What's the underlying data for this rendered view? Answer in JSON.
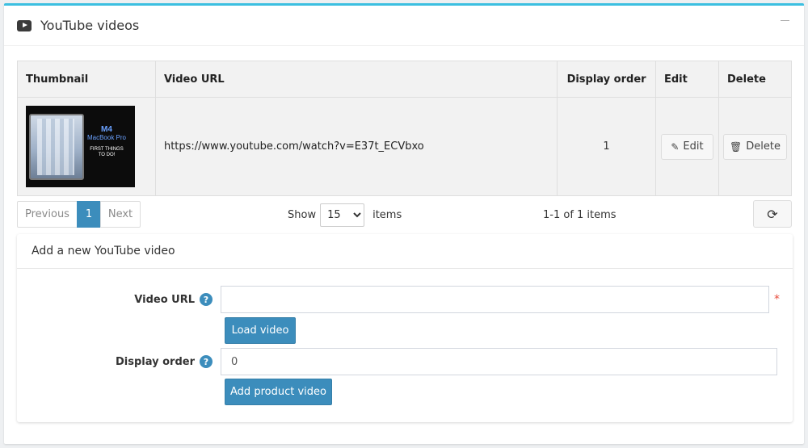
{
  "panel": {
    "title": "YouTube videos",
    "collapse_icon": "minus-icon"
  },
  "table": {
    "headers": {
      "thumbnail": "Thumbnail",
      "video_url": "Video URL",
      "display_order": "Display order",
      "edit": "Edit",
      "delete": "Delete"
    },
    "rows": [
      {
        "thumbnail_text": {
          "line1": "M4",
          "line2": "MacBook Pro",
          "line3": "FIRST THINGS",
          "line4": "TO DO!"
        },
        "video_url": "https://www.youtube.com/watch?v=E37t_ECVbxo",
        "display_order": "1",
        "edit_label": "Edit",
        "delete_label": "Delete"
      }
    ]
  },
  "pager": {
    "previous": "Previous",
    "current_page": "1",
    "next": "Next",
    "show_label": "Show",
    "page_size": "15",
    "items_label": "items",
    "info": "1-1 of 1 items"
  },
  "add_form": {
    "title": "Add a new YouTube video",
    "video_url_label": "Video URL",
    "video_url_value": "",
    "load_button": "Load video",
    "display_order_label": "Display order",
    "display_order_value": "0",
    "add_button": "Add product video",
    "help_icon_text": "?",
    "required_marker": "*"
  },
  "colors": {
    "accent_top": "#3cbfe0",
    "primary": "#3c8dbc",
    "required": "#e74c3c"
  }
}
